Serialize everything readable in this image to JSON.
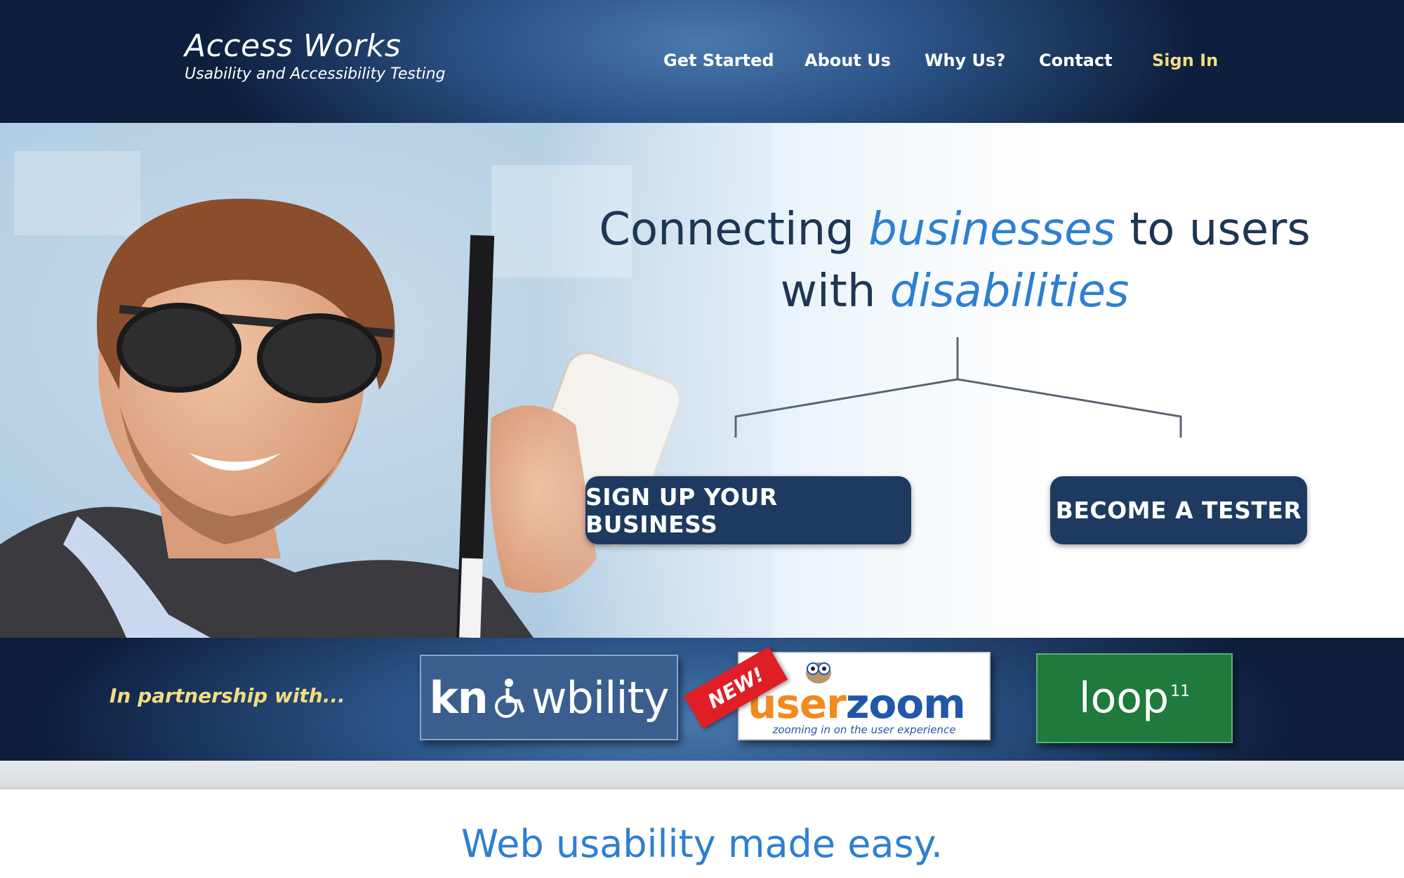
{
  "header": {
    "brand_title": "Access Works",
    "brand_subtitle": "Usability and Accessibility Testing",
    "nav": [
      {
        "label": "Get Started"
      },
      {
        "label": "About Us"
      },
      {
        "label": "Why Us?"
      },
      {
        "label": "Contact"
      },
      {
        "label": "Sign In"
      }
    ],
    "signin_color": "#f2dc83"
  },
  "hero": {
    "headline_part1": "Connecting ",
    "headline_em1": "businesses",
    "headline_part2": " to users",
    "headline_part3": "with ",
    "headline_em2": "disabilities",
    "cta_business": "SIGN UP YOUR BUSINESS",
    "cta_tester": "BECOME A TESTER",
    "photo_subject": "smiling man with sunglasses holding white cane and phone",
    "accent_color": "#2e7fd0",
    "button_color": "#1e3a60"
  },
  "partners": {
    "label": "In partnership with...",
    "knowbility": {
      "prefix": "kn",
      "suffix": "wbility"
    },
    "userzoom": {
      "badge": "NEW!",
      "word_user": "user",
      "word_zoom": "zoom",
      "tagline": "zooming in on the user experience"
    },
    "loop11": {
      "word": "loop",
      "superscript": "11"
    }
  },
  "main": {
    "tagline": "Web usability made easy."
  }
}
